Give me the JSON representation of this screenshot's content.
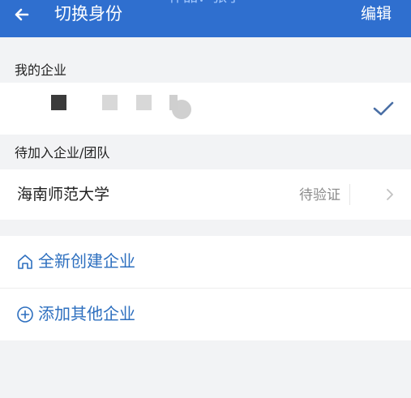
{
  "header": {
    "title": "切换身份",
    "overlay_text": "作品：张学",
    "edit_label": "编辑"
  },
  "my_company": {
    "section_label": "我的企业"
  },
  "pending": {
    "section_label": "待加入企业/团队",
    "name": "海南师范大学",
    "status": "待验证",
    "status_color": "#e04b3f"
  },
  "actions": {
    "create_label": "全新创建企业",
    "add_label": "添加其他企业",
    "accent": "#2d6fbf"
  }
}
